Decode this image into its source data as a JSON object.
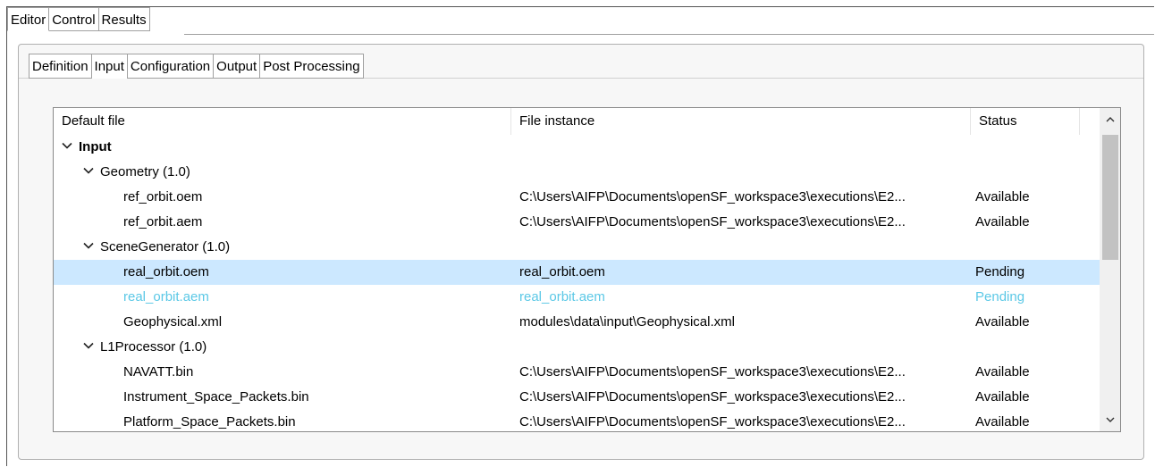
{
  "top_tabs": [
    "Editor",
    "Control",
    "Results"
  ],
  "sub_tabs": [
    "Definition",
    "Input",
    "Configuration",
    "Output",
    "Post Processing"
  ],
  "table": {
    "headers": [
      "Default file",
      "File instance",
      "Status"
    ],
    "rows": [
      {
        "name": "Input",
        "instance": "",
        "status": ""
      },
      {
        "name": "Geometry (1.0)",
        "instance": "",
        "status": ""
      },
      {
        "name": "ref_orbit.oem",
        "instance": "C:\\Users\\AIFP\\Documents\\openSF_workspace3\\executions\\E2...",
        "status": "Available"
      },
      {
        "name": "ref_orbit.aem",
        "instance": "C:\\Users\\AIFP\\Documents\\openSF_workspace3\\executions\\E2...",
        "status": "Available"
      },
      {
        "name": "SceneGenerator (1.0)",
        "instance": "",
        "status": ""
      },
      {
        "name": "real_orbit.oem",
        "instance": "real_orbit.oem",
        "status": "Pending"
      },
      {
        "name": "real_orbit.aem",
        "instance": "real_orbit.aem",
        "status": "Pending"
      },
      {
        "name": "Geophysical.xml",
        "instance": "modules\\data\\input\\Geophysical.xml",
        "status": "Available"
      },
      {
        "name": "L1Processor (1.0)",
        "instance": "",
        "status": ""
      },
      {
        "name": "NAVATT.bin",
        "instance": "C:\\Users\\AIFP\\Documents\\openSF_workspace3\\executions\\E2...",
        "status": "Available"
      },
      {
        "name": "Instrument_Space_Packets.bin",
        "instance": "C:\\Users\\AIFP\\Documents\\openSF_workspace3\\executions\\E2...",
        "status": "Available"
      },
      {
        "name": "Platform_Space_Packets.bin",
        "instance": "C:\\Users\\AIFP\\Documents\\openSF_workspace3\\executions\\E2...",
        "status": "Available"
      }
    ]
  },
  "colors": {
    "selected_row": "#cce8ff",
    "faded_text": "#5bc8e6"
  },
  "icons": {
    "expand": "chevron-down-icon",
    "scroll_up": "chevron-up-icon",
    "scroll_down": "chevron-down-icon"
  }
}
